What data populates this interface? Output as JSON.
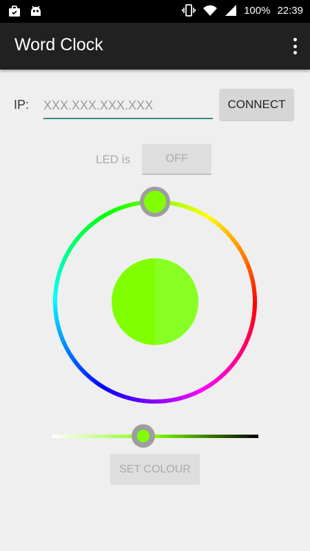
{
  "status_bar": {
    "left_icons": [
      "briefcase-icon",
      "android-icon"
    ],
    "right_icons": [
      "vibrate-icon",
      "wifi-icon",
      "signal-icon"
    ],
    "battery": "100%",
    "time": "22:39"
  },
  "app_bar": {
    "title": "Word Clock",
    "overflow_icon": "more-vert-icon"
  },
  "connection": {
    "ip_label": "IP:",
    "ip_placeholder": "XXX.XXX.XXX.XXX",
    "ip_value": "",
    "connect_label": "CONNECT"
  },
  "led": {
    "label": "LED is",
    "state_label": "OFF"
  },
  "color_picker": {
    "selected_color": "#80ff00",
    "previous_color": "#88ff22",
    "brightness_fraction": 0.44
  },
  "actions": {
    "set_colour_label": "SET COLOUR"
  },
  "colors": {
    "accent": "#2b8b85",
    "app_bar": "#212121",
    "background": "#efefef"
  }
}
